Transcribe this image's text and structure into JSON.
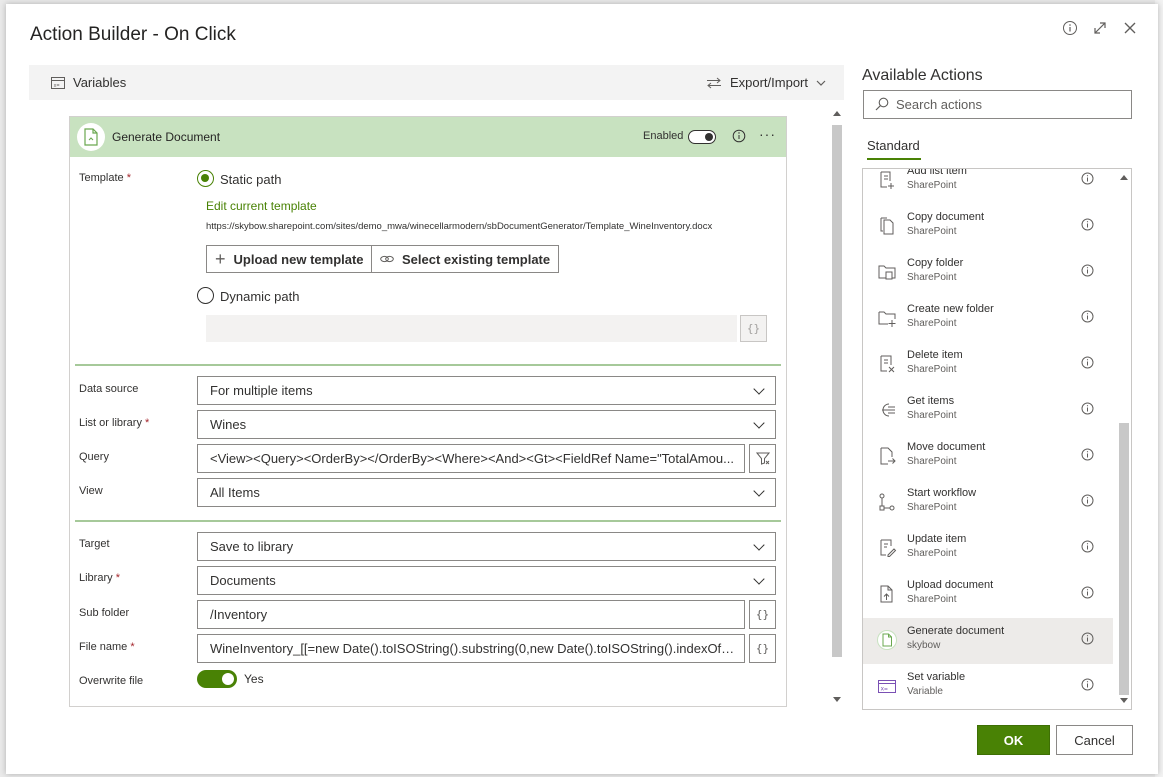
{
  "dialog": {
    "title": "Action Builder - On Click"
  },
  "toolbar": {
    "variables_label": "Variables",
    "export_import_label": "Export/Import"
  },
  "action_card": {
    "title": "Generate Document",
    "enabled_label": "Enabled",
    "more_label": "···"
  },
  "template": {
    "label": "Template",
    "required_mark": "*",
    "static_path_label": "Static path",
    "edit_link": "Edit current template",
    "url": "https://skybow.sharepoint.com/sites/demo_mwa/winecellarmodern/sbDocumentGenerator/Template_WineInventory.docx",
    "upload_label": "Upload new template",
    "select_label": "Select existing template",
    "dynamic_path_label": "Dynamic path",
    "brace": "{}"
  },
  "data_section": {
    "data_source_label": "Data source",
    "data_source_value": "For multiple items",
    "list_label": "List or library",
    "list_value": "Wines",
    "query_label": "Query",
    "query_value": "<View><Query><OrderBy></OrderBy><Where><And><Gt><FieldRef Name=\"TotalAmou...",
    "view_label": "View",
    "view_value": "All Items"
  },
  "target_section": {
    "target_label": "Target",
    "target_value": "Save to library",
    "library_label": "Library",
    "library_value": "Documents",
    "subfolder_label": "Sub folder",
    "subfolder_value": "/Inventory",
    "filename_label": "File name",
    "filename_value": "WineInventory_[[=new Date().toISOString().substring(0,new Date().toISOString().indexOf('T')) ]]",
    "overwrite_label": "Overwrite file",
    "overwrite_value": "Yes"
  },
  "actions_panel": {
    "title": "Available Actions",
    "search_placeholder": "Search actions",
    "tab_label": "Standard",
    "items": [
      {
        "name": "Add list item",
        "source": "SharePoint",
        "icon": "add-list-item-icon"
      },
      {
        "name": "Copy document",
        "source": "SharePoint",
        "icon": "copy-document-icon"
      },
      {
        "name": "Copy folder",
        "source": "SharePoint",
        "icon": "copy-folder-icon"
      },
      {
        "name": "Create new folder",
        "source": "SharePoint",
        "icon": "create-folder-icon"
      },
      {
        "name": "Delete item",
        "source": "SharePoint",
        "icon": "delete-item-icon"
      },
      {
        "name": "Get items",
        "source": "SharePoint",
        "icon": "get-items-icon"
      },
      {
        "name": "Move document",
        "source": "SharePoint",
        "icon": "move-document-icon"
      },
      {
        "name": "Start workflow",
        "source": "SharePoint",
        "icon": "workflow-icon"
      },
      {
        "name": "Update item",
        "source": "SharePoint",
        "icon": "update-item-icon"
      },
      {
        "name": "Upload document",
        "source": "SharePoint",
        "icon": "upload-document-icon"
      },
      {
        "name": "Generate document",
        "source": "skybow",
        "icon": "generate-document-icon"
      },
      {
        "name": "Set variable",
        "source": "Variable",
        "icon": "set-variable-icon"
      }
    ]
  },
  "footer": {
    "ok_label": "OK",
    "cancel_label": "Cancel"
  },
  "colors": {
    "accent": "#498205",
    "card_header": "#c8e2c0"
  }
}
